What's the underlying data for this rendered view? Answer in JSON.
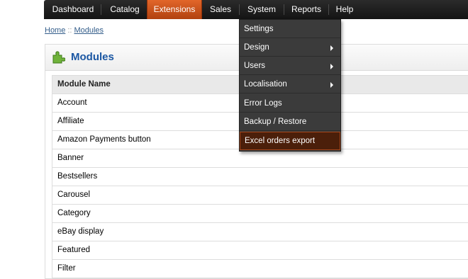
{
  "nav": {
    "items": [
      {
        "label": "Dashboard"
      },
      {
        "label": "Catalog"
      },
      {
        "label": "Extensions",
        "active": true
      },
      {
        "label": "Sales"
      },
      {
        "label": "System"
      },
      {
        "label": "Reports"
      },
      {
        "label": "Help"
      }
    ]
  },
  "breadcrumb": {
    "home": "Home",
    "separator": "::",
    "current": "Modules"
  },
  "page": {
    "title": "Modules",
    "title_icon": "puzzle-piece-icon"
  },
  "table": {
    "header": "Module Name",
    "rows": [
      "Account",
      "Affiliate",
      "Amazon Payments button",
      "Banner",
      "Bestsellers",
      "Carousel",
      "Category",
      "eBay display",
      "Featured",
      "Filter"
    ]
  },
  "dropdown": {
    "items": [
      {
        "label": "Settings",
        "has_submenu": false
      },
      {
        "label": "Design",
        "has_submenu": true
      },
      {
        "label": "Users",
        "has_submenu": true
      },
      {
        "label": "Localisation",
        "has_submenu": true
      },
      {
        "label": "Error Logs",
        "has_submenu": false
      },
      {
        "label": "Backup / Restore",
        "has_submenu": false
      },
      {
        "label": "Excel orders export",
        "has_submenu": false,
        "highlighted": true
      }
    ]
  },
  "colors": {
    "nav_bg": "#1c1c1c",
    "nav_active": "#c9521a",
    "title": "#1b57a3",
    "dropdown_bg": "#3b3b3b",
    "dropdown_highlight": "#4b1f0a"
  }
}
